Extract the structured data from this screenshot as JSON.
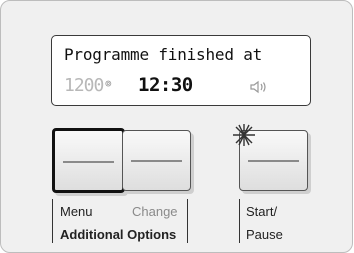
{
  "display": {
    "message": "Programme finished at",
    "spin_speed": "1200",
    "finish_time": "12:30"
  },
  "icons": {
    "spin": "spin-icon",
    "sound": "speaker-icon",
    "start_indicator": "sparkle-icon"
  },
  "buttons": {
    "menu_label": "Menu",
    "change_label": "Change",
    "group_label": "Additional Options",
    "start_label_line1": "Start/",
    "start_label_line2": "Pause"
  },
  "colors": {
    "panel": "#f0f0f0",
    "dim_digits": "#b8b8b8",
    "text": "#111111"
  }
}
